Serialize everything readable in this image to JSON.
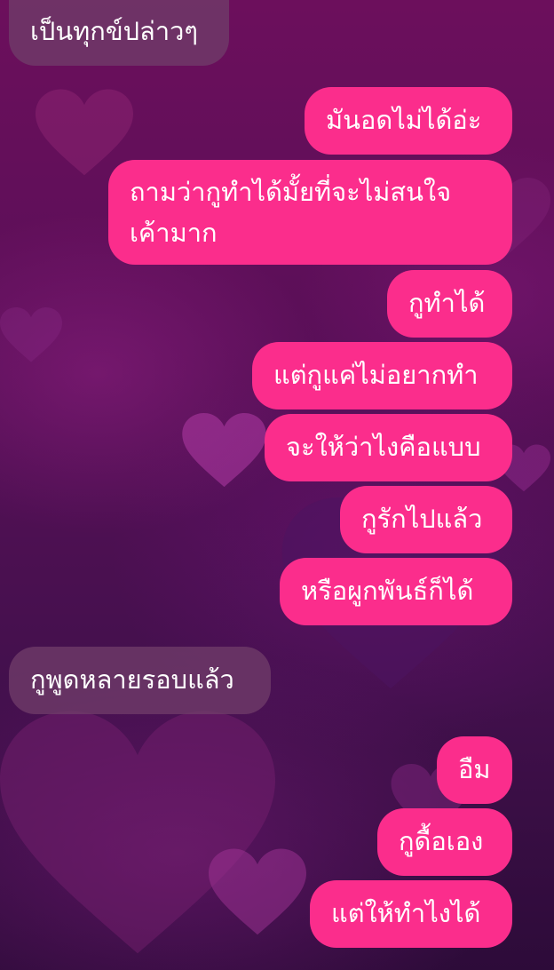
{
  "theme": {
    "outgoing_bubble_color": "#fb2d8c",
    "incoming_bubble_color": "#703c69",
    "background_top": "#6c0f5c",
    "background_bottom": "#2d0b39",
    "background_motif": "heart-icon"
  },
  "messages": [
    {
      "direction": "incoming",
      "text": "เป็นทุกข์ปล่าวๆ"
    },
    {
      "direction": "outgoing",
      "text": "มันอดไม่ได้อ่ะ"
    },
    {
      "direction": "outgoing",
      "text": "ถามว่ากูทำได้มั้ยที่จะไม่สนใจเค้ามาก"
    },
    {
      "direction": "outgoing",
      "text": "กูทำได้"
    },
    {
      "direction": "outgoing",
      "text": "แต่กูแค่ไม่อยากทำ"
    },
    {
      "direction": "outgoing",
      "text": "จะให้ว่าไงคือแบบ"
    },
    {
      "direction": "outgoing",
      "text": "กูรักไปแล้ว"
    },
    {
      "direction": "outgoing",
      "text": "หรือผูกพันธ์ก็ได้"
    },
    {
      "direction": "incoming",
      "text": "กูพูดหลายรอบแล้ว"
    },
    {
      "direction": "outgoing",
      "text": "อืม"
    },
    {
      "direction": "outgoing",
      "text": "กูดื้อเอง"
    },
    {
      "direction": "outgoing",
      "text": "แต่ให้ทำไงได้"
    }
  ]
}
